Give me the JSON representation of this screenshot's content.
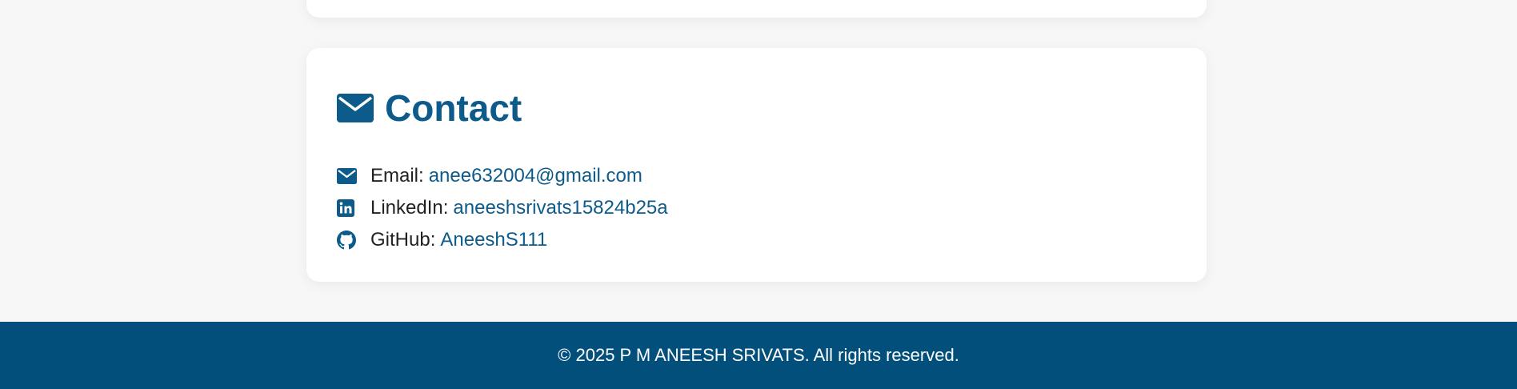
{
  "colors": {
    "background": "#f7f7f7",
    "card": "#ffffff",
    "accent": "#0c5b8a",
    "footer": "#034f7c"
  },
  "contact": {
    "title": "Contact",
    "title_icon": "envelope-icon",
    "items": [
      {
        "label": "Email:",
        "value": "anee632004@gmail.com",
        "icon": "envelope-icon"
      },
      {
        "label": "LinkedIn:",
        "value": "aneeshsrivats15824b25a",
        "icon": "linkedin-icon"
      },
      {
        "label": "GitHub:",
        "value": "AneeshS111",
        "icon": "github-icon"
      }
    ]
  },
  "footer": {
    "text": "© 2025 P M ANEESH SRIVATS. All rights reserved."
  }
}
